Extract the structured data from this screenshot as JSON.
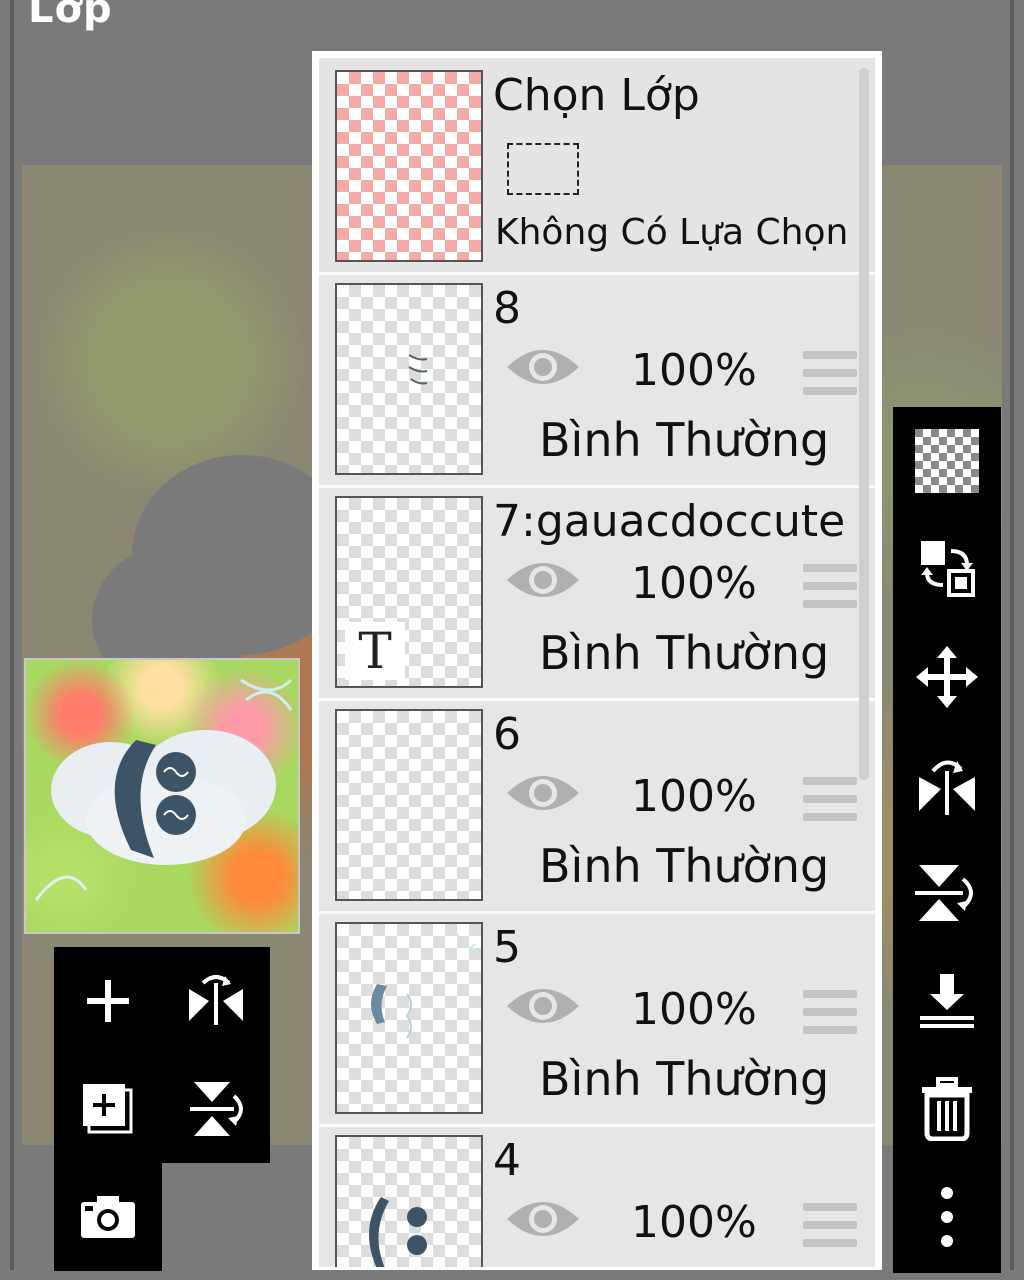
{
  "header": {
    "title": "Lớp"
  },
  "selection": {
    "title": "Chọn Lớp",
    "status": "Không Có Lựa Chọn"
  },
  "layers": [
    {
      "name": "8",
      "opacity": "100%",
      "mode": "Bình Thường"
    },
    {
      "name": "7:gauacdoccute",
      "opacity": "100%",
      "mode": "Bình Thường"
    },
    {
      "name": "6",
      "opacity": "100%",
      "mode": "Bình Thường"
    },
    {
      "name": "5",
      "opacity": "100%",
      "mode": "Bình Thường"
    },
    {
      "name": "4",
      "opacity": "100%",
      "mode": ""
    }
  ],
  "text_layer_glyph": "T",
  "left_tools": [
    "add-layer-icon",
    "flip-horizontal-icon",
    "add-copy-layer-icon",
    "flip-vertical-icon",
    "camera-icon"
  ],
  "right_tools": [
    "transparency-icon",
    "swap-layers-icon",
    "move-icon",
    "flip-horizontal-icon",
    "flip-vertical-icon",
    "merge-down-icon",
    "trash-icon",
    "more-icon"
  ],
  "colors": {
    "panel_bg": "#e6e6e6",
    "toolbar_bg": "#000000",
    "backdrop": "#7a7a7a",
    "checker_pink": "#f4aaa6"
  }
}
